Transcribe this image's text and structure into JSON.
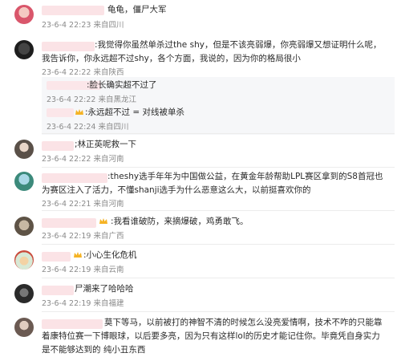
{
  "comments": [
    {
      "id": 1,
      "text": "龟龟，僵尸大军",
      "meta": "23-6-4 22:23 来自四川"
    },
    {
      "id": 2,
      "text": ":我觉得你虽然单杀过the shy，但是不该亮弱爆，你亮弱爆又想证明什么呢，我告诉你，你永远超不过shy，各个方面，我说的，因为你的格局很小",
      "meta": "23-6-4 22:22 来自陕西",
      "replies": [
        {
          "text": ":脸长确实超不过了",
          "meta": "23-6-4 22:22 来自黑龙江"
        },
        {
          "text": ":永远超不过 = 对线被单杀",
          "meta": "23-6-4 22:24 来自四川"
        }
      ]
    },
    {
      "id": 3,
      "text": ";林正英呢救一下",
      "meta": "23-6-4 22:22 来自河南"
    },
    {
      "id": 4,
      "text": ":theshy选手年年为中国做公益，在黄金年龄帮助LPL赛区拿到的S8首冠也为赛区注入了活力，不懂shanji选手为什么恶意这么大，以前挺喜欢你的",
      "meta": "23-6-4 22:21 来自河南"
    },
    {
      "id": 5,
      "text": ":我看谁破防，来摘爆破，鸡勇敢飞。",
      "meta": "23-6-4 22:19 来自广西"
    },
    {
      "id": 6,
      "text": ":小心生化危机",
      "meta": "23-6-4 22:19 来自云南"
    },
    {
      "id": 7,
      "text": "尸潮来了哈哈哈",
      "meta": "23-6-4 22:19 来自福建"
    },
    {
      "id": 8,
      "text": "莫下等马，以前被打的神智不清的时候怎么没亮爱情啊，技术不咋的只能靠着康特位赛一下博眼球，以后要多亮，因为只有这样lol的历史才能记住你。毕竟凭自身实力是不能够达到的 纯小丑东西",
      "meta": ""
    }
  ]
}
